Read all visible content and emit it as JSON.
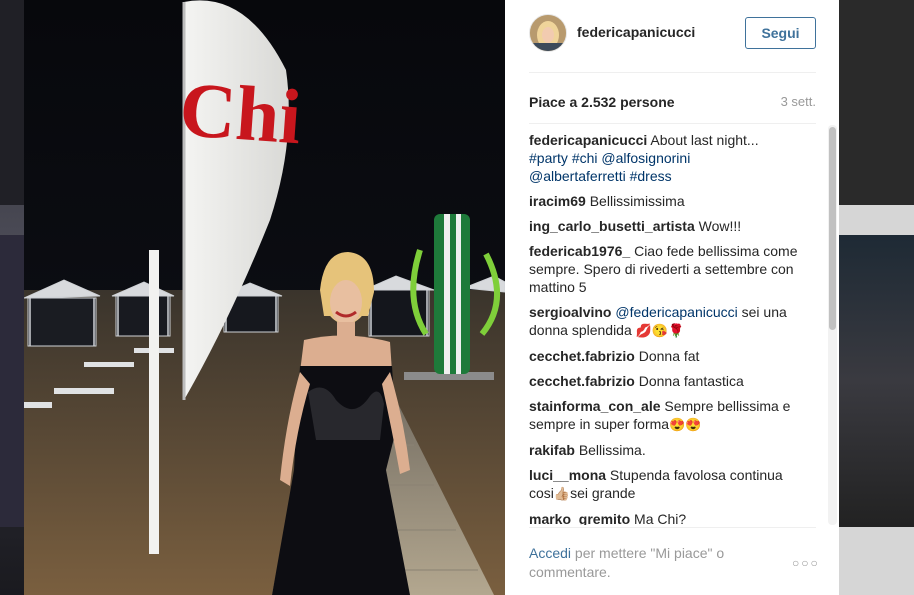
{
  "post": {
    "username": "federicapanicucci",
    "follow_label": "Segui",
    "likes_text": "Piace a 2.532 persone",
    "time_text": "3 sett.",
    "photo_sign_text": "Chi"
  },
  "caption": {
    "username": "federicapanicucci",
    "text": "About last night...",
    "tags": [
      "#party",
      "#chi",
      "@alfosignorini",
      "@albertaferretti",
      "#dress"
    ]
  },
  "comments": [
    {
      "username": "iracim69",
      "text": "Bellissimissima"
    },
    {
      "username": "ing_carlo_busetti_artista",
      "text": "Wow!!!"
    },
    {
      "username": "federicab1976_",
      "text": "Ciao fede bellissima come sempre. Spero di rivederti a settembre con mattino 5"
    },
    {
      "username": "sergioalvino",
      "mention": "@federicapanicucci",
      "text": "sei una donna splendida",
      "emoji": "💋😘🌹"
    },
    {
      "username": "cecchet.fabrizio",
      "text": "Donna fat"
    },
    {
      "username": "cecchet.fabrizio",
      "text": "Donna fantastica"
    },
    {
      "username": "stainforma_con_ale",
      "text": "Sempre bellissima e sempre in super forma",
      "emoji": "😍😍"
    },
    {
      "username": "rakifab",
      "text": "Bellissima."
    },
    {
      "username": "luci__mona",
      "text": "Stupenda favolosa continua cosi",
      "emoji": "👍🏼",
      "text_after": "sei grande"
    },
    {
      "username": "marko_gremito",
      "text": "Ma Chi?"
    }
  ],
  "footer": {
    "login_label": "Accedi",
    "rest_text": "per mettere \"Mi piace\" o commentare.",
    "more_label": "○○○"
  },
  "colors": {
    "link": "#3f729b",
    "tag": "#003569",
    "text": "#262626",
    "muted": "#999999"
  }
}
